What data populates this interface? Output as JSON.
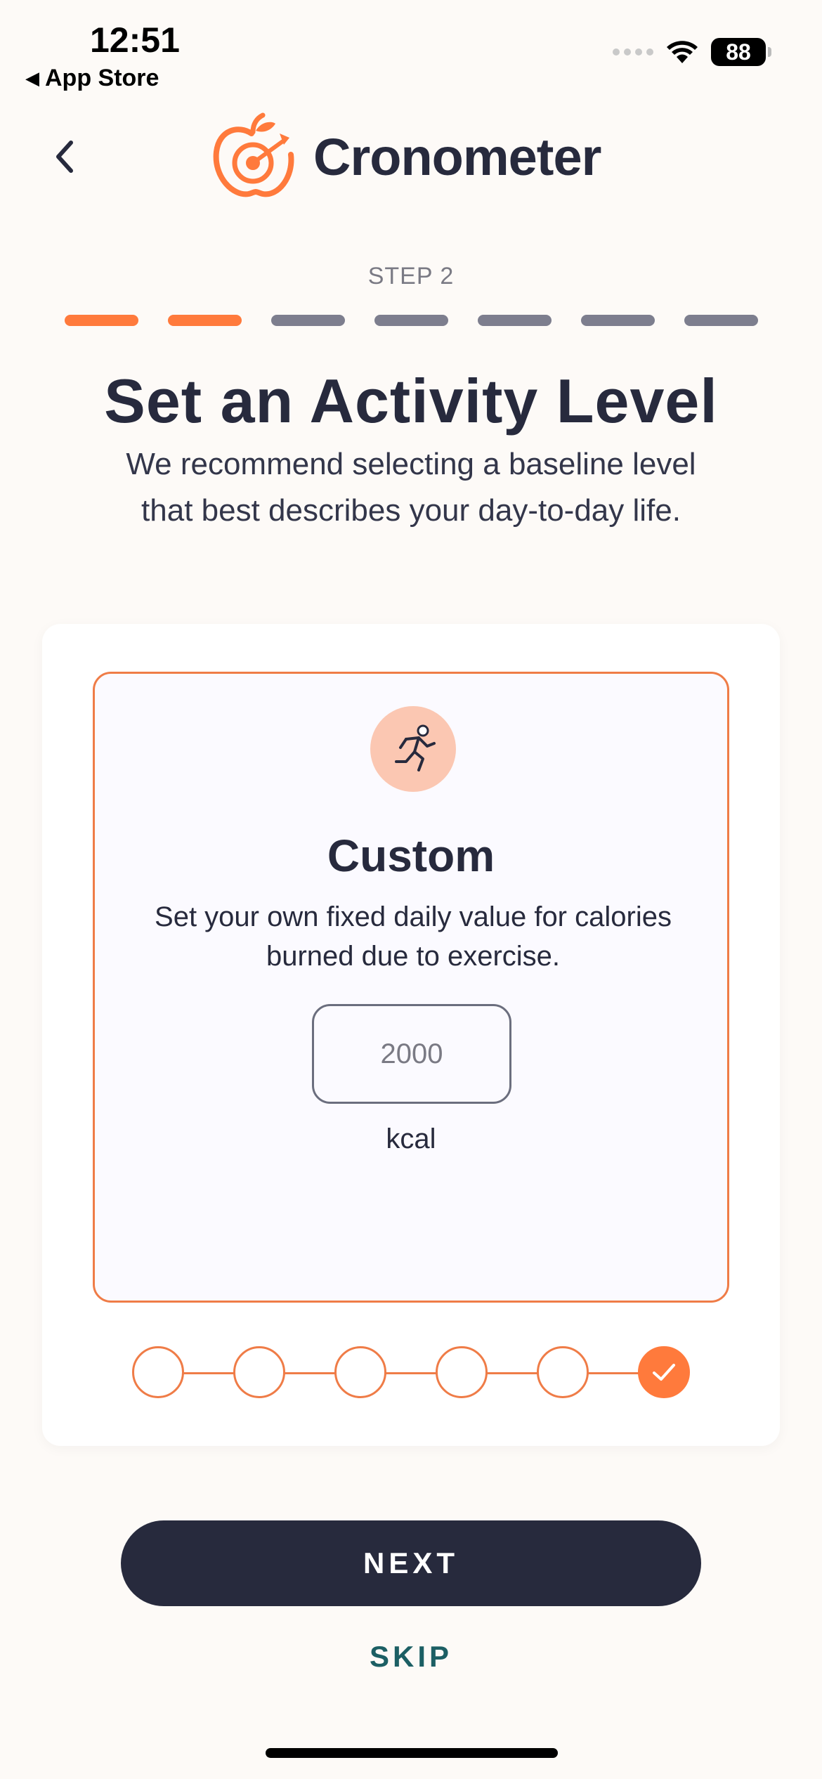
{
  "status_bar": {
    "time": "12:51",
    "back_label": "App Store",
    "back_icon": "triangle-left-icon",
    "battery": "88",
    "wifi_icon": "wifi-icon"
  },
  "header": {
    "brand_name": "Cronometer",
    "logo_icon": "apple-target-logo-icon",
    "back_icon": "chevron-left-icon"
  },
  "step": {
    "label": "STEP 2",
    "current": 2,
    "total": 7,
    "active_color": "#ff7a3c",
    "inactive_color": "#7d7e8e"
  },
  "page": {
    "title": "Set an Activity Level",
    "subtitle": "We recommend selecting a baseline level that best describes your day-to-day life."
  },
  "option": {
    "icon": "running-person-icon",
    "title": "Custom",
    "description": "Set your own fixed daily value for calories burned due to exercise.",
    "input_placeholder": "2000",
    "unit": "kcal",
    "accent_color": "#ef7c47"
  },
  "level_selector": {
    "count": 6,
    "selected_index": 5
  },
  "actions": {
    "next_label": "NEXT",
    "skip_label": "SKIP"
  }
}
